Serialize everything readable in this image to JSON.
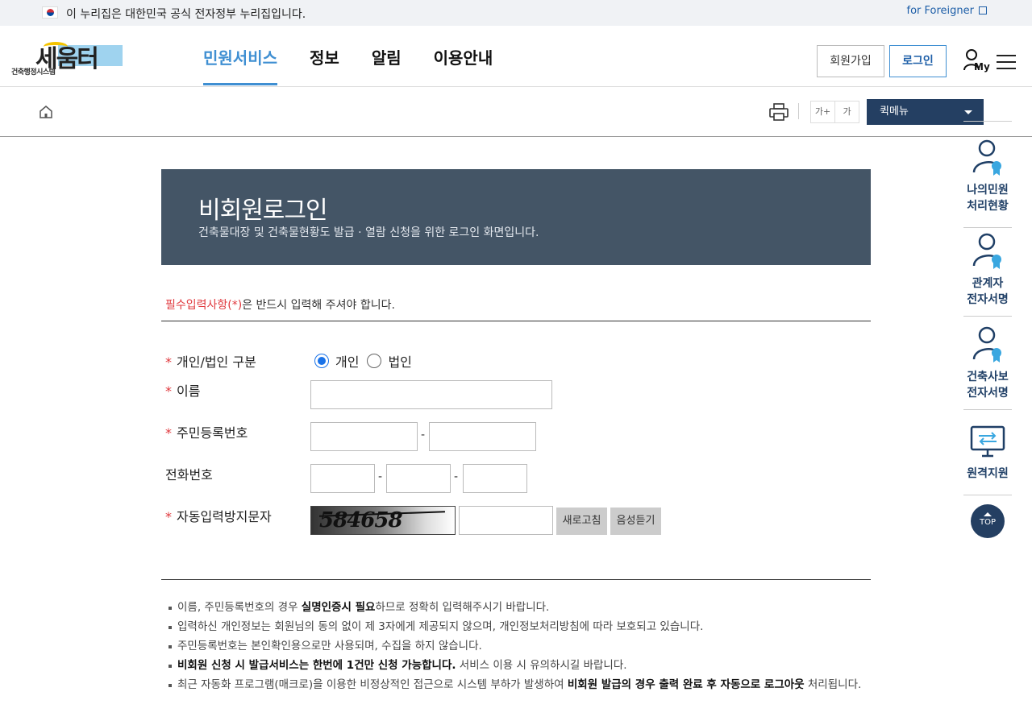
{
  "gov_banner": {
    "text": "이 누리집은 대한민국 공식 전자정부 누리집입니다.",
    "foreigner_link": "for Foreigner"
  },
  "header": {
    "logo_main": "세움터",
    "logo_sub": "건축행정시스템",
    "nav": [
      "민원서비스",
      "정보",
      "알림",
      "이용안내"
    ],
    "join_label": "회원가입",
    "login_label": "로그인",
    "my_label": "My"
  },
  "subbar": {
    "font_plus": "가+",
    "font_minus": "가",
    "quick_menu": "퀵메뉴"
  },
  "page": {
    "title": "비회원로그인",
    "subtitle": "건축물대장 및 건축물현황도 발급 · 열람 신청을 위한 로그인 화면입니다.",
    "required_red": "필수입력사항(*)",
    "required_rest": "은 반드시 입력해 주셔야 합니다."
  },
  "form": {
    "star": "*",
    "type_label": "개인/법인 구분",
    "radio_individual": "개인",
    "radio_corporate": "법인",
    "name_label": "이름",
    "rrn_label": "주민등록번호",
    "phone_label": "전화번호",
    "captcha_label": "자동입력방지문자",
    "captcha_text": "584658",
    "refresh_label": "새로고침",
    "audio_label": "음성듣기",
    "dash": "-"
  },
  "notes": {
    "n1_pre": "이름, 주민등록번호의 경우 ",
    "n1_bold": "실명인증시 필요",
    "n1_post": "하므로 정확히 입력해주시기 바랍니다.",
    "n2": "입력하신 개인정보는 회원님의 동의 없이 제 3자에게 제공되지 않으며, 개인정보처리방침에 따라 보호되고 있습니다.",
    "n3": "주민등록번호는 본인확인용으로만 사용되며, 수집을 하지 않습니다.",
    "n4_bold": "비회원 신청 시 발급서비스는 한번에 1건만 신청 가능합니다.",
    "n4_post": " 서비스 이용 시 유의하시길 바랍니다.",
    "n5_pre": "최근 자동화 프로그램(매크로)을 이용한 비정상적인 접근으로 시스템 부하가 발생하여 ",
    "n5_bold": "비회원 발급의 경우 출력 완료 후 자동으로 로그아웃",
    "n5_post": " 처리됩니다."
  },
  "side": {
    "item1_line1": "나의민원",
    "item1_line2": "처리현황",
    "item2_line1": "관계자",
    "item2_line2": "전자서명",
    "item3_line1": "건축사보",
    "item3_line2": "전자서명",
    "item4": "원격지원",
    "top": "TOP"
  },
  "colors": {
    "accent": "#3f8fd2",
    "navy": "#243f62",
    "title_bg": "#445566",
    "required": "#e0393e"
  }
}
